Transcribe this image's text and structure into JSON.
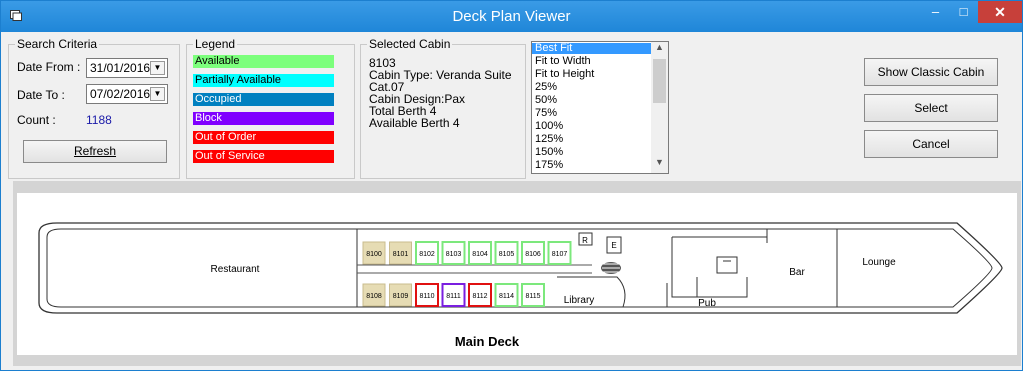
{
  "window": {
    "title": "Deck Plan Viewer",
    "min": "–",
    "max": "□",
    "close": "✕"
  },
  "search": {
    "caption": "Search Criteria",
    "date_from_label": "Date From :",
    "date_from": "31/01/2016",
    "date_to_label": "Date To :",
    "date_to": "07/02/2016",
    "count_label": "Count :",
    "count": "1188",
    "refresh": "Refresh"
  },
  "legend": {
    "caption": "Legend",
    "items": [
      {
        "label": "Available",
        "color": "#7cff7c",
        "text_color": "#000000"
      },
      {
        "label": "Partially Available",
        "color": "#00ffff",
        "text_color": "#000000"
      },
      {
        "label": "Occupied",
        "color": "#0080c0",
        "text_color": "#ffffff"
      },
      {
        "label": "Block",
        "color": "#8000ff",
        "text_color": "#ffffff"
      },
      {
        "label": "Out of Order",
        "color": "#ff0000",
        "text_color": "#ffffff"
      },
      {
        "label": "Out of Service",
        "color": "#ff0000",
        "text_color": "#ffffff"
      }
    ]
  },
  "selected": {
    "caption": "Selected Cabin",
    "lines": [
      "8103",
      "Cabin Type: Veranda Suite",
      "Cat.07",
      "Cabin Design:Pax",
      "Total Berth 4",
      "Available Berth 4"
    ]
  },
  "zoom": {
    "options": [
      "Best Fit",
      "Fit to Width",
      "Fit to Height",
      "25%",
      "50%",
      "75%",
      "100%",
      "125%",
      "150%",
      "175%"
    ],
    "selected": "Best Fit"
  },
  "buttons": {
    "classic": "Show Classic Cabin",
    "select": "Select",
    "cancel": "Cancel"
  },
  "deck": {
    "name": "Main Deck",
    "labels": {
      "restaurant": "Restaurant",
      "library": "Library",
      "pub": "Pub",
      "bar": "Bar",
      "lounge": "Lounge",
      "r": "R",
      "e": "E"
    },
    "top_row": [
      {
        "no": "8100",
        "status": "tan"
      },
      {
        "no": "8101",
        "status": "tan"
      },
      {
        "no": "8102",
        "status": "available"
      },
      {
        "no": "8103",
        "status": "available"
      },
      {
        "no": "8104",
        "status": "available"
      },
      {
        "no": "8105",
        "status": "available"
      },
      {
        "no": "8106",
        "status": "available"
      },
      {
        "no": "8107",
        "status": "available"
      }
    ],
    "bottom_row": [
      {
        "no": "8108",
        "status": "tan"
      },
      {
        "no": "8109",
        "status": "tan"
      },
      {
        "no": "8110",
        "status": "red"
      },
      {
        "no": "8111",
        "status": "block"
      },
      {
        "no": "8112",
        "status": "red"
      },
      {
        "no": "8114",
        "status": "available"
      },
      {
        "no": "8115",
        "status": "available"
      }
    ]
  }
}
